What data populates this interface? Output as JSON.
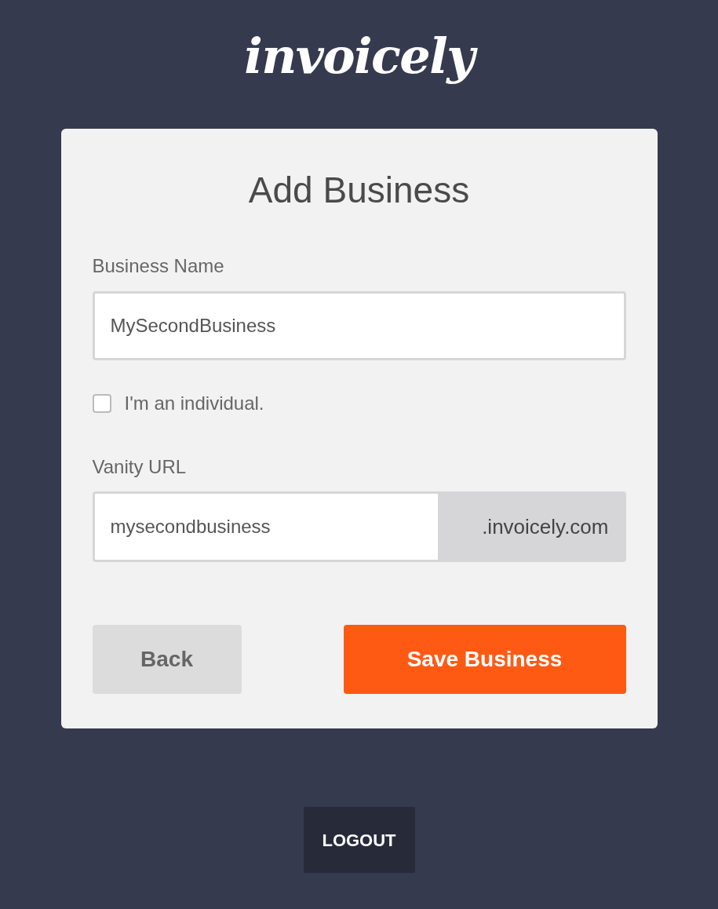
{
  "logo": "invoicely",
  "card": {
    "title": "Add Business",
    "business_name": {
      "label": "Business Name",
      "value": "MySecondBusiness"
    },
    "individual": {
      "label": "I'm an individual.",
      "checked": false
    },
    "vanity_url": {
      "label": "Vanity URL",
      "value": "mysecondbusiness",
      "suffix": ".invoicely.com"
    },
    "buttons": [
      {
        "label": "Back",
        "kind": "secondary"
      },
      {
        "label": "Save Business",
        "kind": "primary"
      }
    ]
  },
  "logout": "LOGOUT"
}
